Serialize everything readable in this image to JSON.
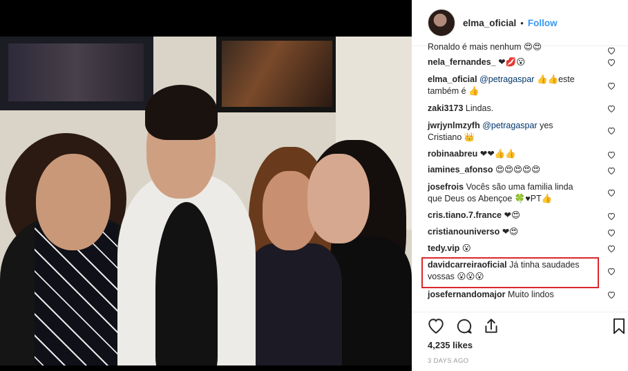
{
  "post": {
    "username": "elma_oficial",
    "separator": "•",
    "follow_label": "Follow",
    "likes": "4,235 likes",
    "time_ago": "3 DAYS AGO"
  },
  "comments": [
    {
      "user": "",
      "text": "Ronaldo é mais nenhum 😍😍"
    },
    {
      "user": "nela_fernandes_",
      "text": "❤💋😮"
    },
    {
      "user": "elma_oficial",
      "mention": "@petragaspar",
      "text": " 👍👍este",
      "text2": "também é 👍"
    },
    {
      "user": "zaki3173",
      "text": "Lindas."
    },
    {
      "user": "jwrjynlmzyfh",
      "mention": "@petragaspar",
      "text": " yes",
      "text2": "Cristiano 👑"
    },
    {
      "user": "robinaabreu",
      "text": "❤❤👍👍"
    },
    {
      "user": "iamines_afonso",
      "text": "😍😍😍😍😍"
    },
    {
      "user": "josefrois",
      "text": "Vocês são uma familia linda",
      "text2": "que Deus os Abençoe 🍀♥PT👍"
    },
    {
      "user": "cris.tiano.7.france",
      "text": "❤😍"
    },
    {
      "user": "cristianouniverso",
      "text": "❤😍"
    },
    {
      "user": "tedy.vip",
      "text": "😮"
    },
    {
      "user": "davidcarreiraoficial",
      "text": "Já tinha saudades",
      "text2": "vossas 😮😮😮"
    },
    {
      "user": "josefernandomajor",
      "text": "Muito lindos"
    }
  ],
  "icons": {
    "like": "heart-icon",
    "comment": "comment-icon",
    "share": "share-icon",
    "save": "bookmark-icon",
    "comment_like": "heart-small-icon"
  },
  "colors": {
    "follow_blue": "#3897f0",
    "highlight_red": "#d9262b",
    "mention": "#003569"
  }
}
